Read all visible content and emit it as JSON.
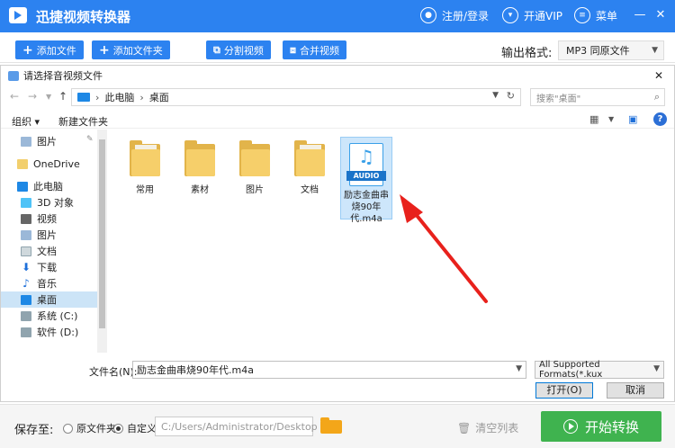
{
  "app": {
    "title": "迅捷视频转换器",
    "login": "注册/登录",
    "vip": "开通VIP",
    "menu": "菜单",
    "minimize": "—",
    "close": "✕"
  },
  "toolbar": {
    "add_file": "添加文件",
    "add_folder": "添加文件夹",
    "split_video": "分割视频",
    "merge_video": "合并视频",
    "format_label": "输出格式:",
    "format_value": "MP3  同原文件"
  },
  "dialog": {
    "title": "请选择音视频文件",
    "close": "✕",
    "address": [
      "此电脑",
      "桌面"
    ],
    "search_placeholder": "搜索\"桌面\"",
    "organize": "组织",
    "new_folder": "新建文件夹",
    "help": "?",
    "nav_items": [
      {
        "label": "图片",
        "pinned": true
      },
      {
        "label": "OneDrive"
      },
      {
        "label": "此电脑"
      },
      {
        "label": "3D 对象"
      },
      {
        "label": "视频"
      },
      {
        "label": "图片"
      },
      {
        "label": "文档"
      },
      {
        "label": "下载"
      },
      {
        "label": "音乐"
      },
      {
        "label": "桌面",
        "selected": true
      },
      {
        "label": "系统 (C:)"
      },
      {
        "label": "软件 (D:)"
      }
    ],
    "files": [
      {
        "label": "常用",
        "type": "folder"
      },
      {
        "label": "素材",
        "type": "folder"
      },
      {
        "label": "图片",
        "type": "folder"
      },
      {
        "label": "文档",
        "type": "folder"
      }
    ],
    "selected_file": {
      "label": "励志金曲串烧90年代.m4a",
      "badge": "AUDIO"
    },
    "filename_label": "文件名(N):",
    "filename_value": "励志金曲串烧90年代.m4a",
    "filetype_value": "All Supported Formats(*.kux",
    "open_button": "打开(O)",
    "cancel_button": "取消"
  },
  "bottom": {
    "save_to": "保存至:",
    "radio_original": "原文件夹",
    "radio_custom": "自定义",
    "path": "C:/Users/Administrator/Desktop",
    "clear_list": "清空列表",
    "start": "开始转换"
  },
  "colors": {
    "brand": "#2c82f0",
    "start": "#3fb34f",
    "arrow": "#e8211c"
  }
}
